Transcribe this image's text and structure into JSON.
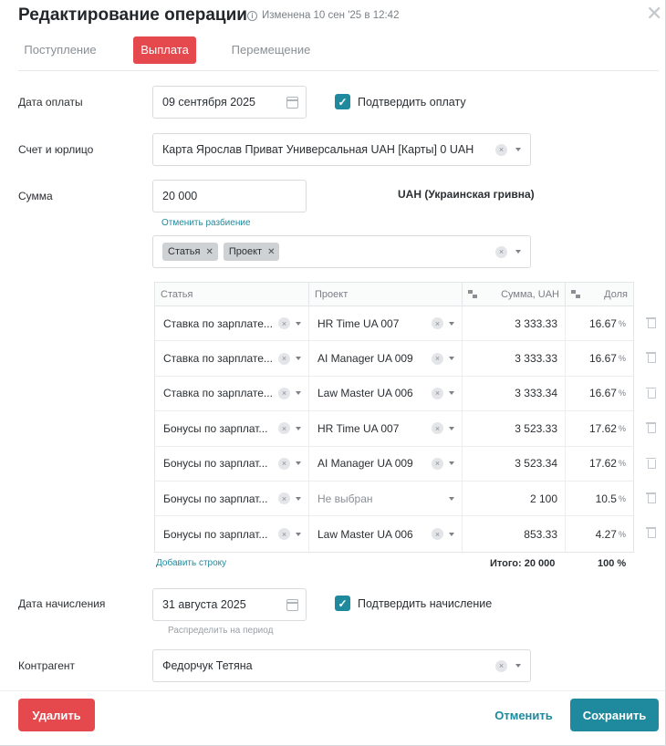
{
  "header": {
    "title": "Редактирование операции",
    "modified": "Изменена 10 сен '25 в 12:42",
    "close_icon": "close-icon"
  },
  "tabs": [
    {
      "label": "Поступление",
      "active": false
    },
    {
      "label": "Выплата",
      "active": true
    },
    {
      "label": "Перемещение",
      "active": false
    }
  ],
  "payment_date": {
    "label": "Дата оплаты",
    "value": "09 сентября 2025",
    "confirm_label": "Подтвердить оплату",
    "confirmed": true
  },
  "account": {
    "label": "Счет и юрлицо",
    "value": "Карта Ярослав Приват Универсальная UAH [Карты] 0 UAH"
  },
  "amount": {
    "label": "Сумма",
    "value": "20 000",
    "currency": "UAH (Украинская гривна)",
    "cancel_split": "Отменить разбиение"
  },
  "split_by": {
    "chips": [
      "Статья",
      "Проект"
    ]
  },
  "table": {
    "headers": {
      "article": "Статья",
      "project": "Проект",
      "sum": "Сумма, UAH",
      "share": "Доля"
    },
    "rows": [
      {
        "article": "Ставка по зарплате...",
        "project": "HR Time UA 007",
        "sum": "3 333.33",
        "share": "16.67"
      },
      {
        "article": "Ставка по зарплате...",
        "project": "AI Manager UA 009",
        "sum": "3 333.33",
        "share": "16.67"
      },
      {
        "article": "Ставка по зарплате...",
        "project": "Law Master UA 006",
        "sum": "3 333.34",
        "share": "16.67"
      },
      {
        "article": "Бонусы по зарплат...",
        "project": "HR Time UA 007",
        "sum": "3 523.33",
        "share": "17.62"
      },
      {
        "article": "Бонусы по зарплат...",
        "project": "AI Manager UA 009",
        "sum": "3 523.34",
        "share": "17.62"
      },
      {
        "article": "Бонусы по зарплат...",
        "project": "Не выбран",
        "sum": "2 100",
        "share": "10.5"
      },
      {
        "article": "Бонусы по зарплат...",
        "project": "Law Master UA 006",
        "sum": "853.33",
        "share": "4.27"
      }
    ],
    "percent_sign": "%",
    "add_row": "Добавить строку",
    "total": "Итого: 20 000",
    "total_share": "100 %"
  },
  "accrual_date": {
    "label": "Дата начисления",
    "value": "31 августа 2025",
    "confirm_label": "Подтвердить начисление",
    "confirmed": true,
    "distribute": "Распределить на период"
  },
  "counterparty": {
    "label": "Контрагент",
    "value": "Федорчук Тетяна"
  },
  "footer": {
    "delete": "Удалить",
    "cancel": "Отменить",
    "save": "Сохранить"
  },
  "colors": {
    "accent": "#1f8a9e",
    "danger": "#e5484d"
  }
}
